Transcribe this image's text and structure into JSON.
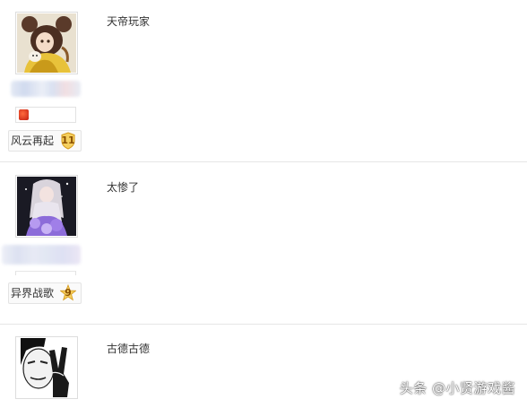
{
  "posts": [
    {
      "content": "天帝玩家",
      "badge": {
        "label": "风云再起",
        "level": "11"
      },
      "avatar_icon": "anime-girl-yellow-avatar-icon",
      "has_mini_icon": true
    },
    {
      "content": "太惨了",
      "badge": {
        "label": "异界战歌",
        "level": "9"
      },
      "avatar_icon": "anime-girl-purple-avatar-icon",
      "has_mini_icon": false
    },
    {
      "content": "古德古德",
      "avatar_icon": "meme-face-victory-sign-avatar-icon"
    }
  ],
  "watermark": "头条 @小贤游戏酱",
  "colors": {
    "divider": "#e6e6e6",
    "text": "#333333",
    "badge_gold": "#f2c14e"
  }
}
